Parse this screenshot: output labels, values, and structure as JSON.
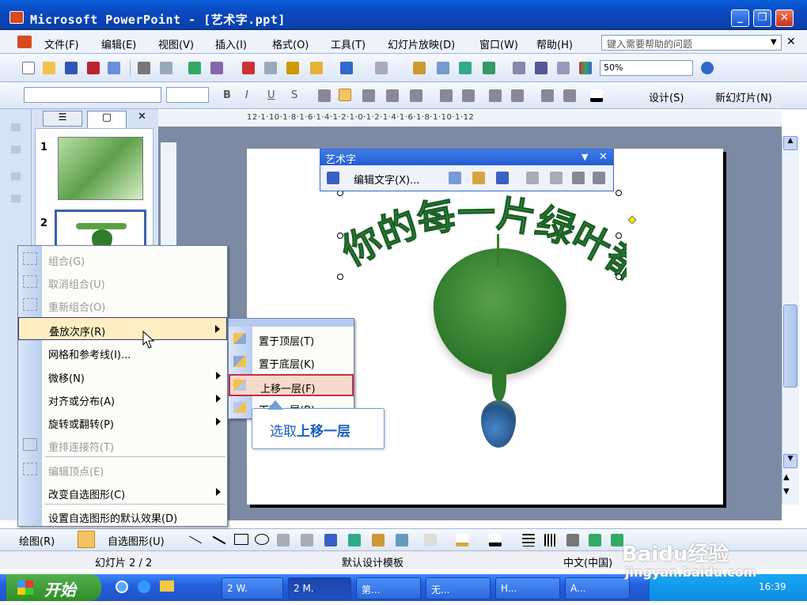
{
  "window": {
    "title": "Microsoft PowerPoint - [艺术字.ppt]",
    "min": "_",
    "restore": "❐",
    "close": "✕"
  },
  "menu": {
    "items": [
      "文件(F)",
      "编辑(E)",
      "视图(V)",
      "插入(I)",
      "格式(O)",
      "工具(T)",
      "幻灯片放映(D)",
      "窗口(W)",
      "帮助(H)"
    ],
    "help_placeholder": "键入需要帮助的问题"
  },
  "toolbar": {
    "zoom": "50%"
  },
  "format_bar": {
    "bold": "B",
    "italic": "I",
    "underline": "U",
    "shadow": "S",
    "design_label": "设计(S)",
    "new_slide_label": "新幻灯片(N)"
  },
  "ruler": {
    "text": "12·1·10·1·8·1·6·1·4·1·2·1·0·1·2·1·4·1·6·1·8·1·10·1·12"
  },
  "thumbs": {
    "tab_outline": "☰",
    "tab_slides": "▢",
    "close": "✕",
    "slide1": "1",
    "slide2": "2"
  },
  "wordart_toolbar": {
    "title": "艺术字",
    "edit_text": "编辑文字(X)..."
  },
  "slide": {
    "wordart": "你的每一片绿叶都是"
  },
  "context_menu": {
    "items": [
      {
        "label": "组合(G)",
        "disabled": true
      },
      {
        "label": "取消组合(U)",
        "disabled": true
      },
      {
        "label": "重新组合(O)",
        "disabled": true
      },
      {
        "label": "叠放次序(R)",
        "disabled": false
      },
      {
        "label": "网格和参考线(I)...",
        "disabled": false
      },
      {
        "label": "微移(N)",
        "disabled": false
      },
      {
        "label": "对齐或分布(A)",
        "disabled": false
      },
      {
        "label": "旋转或翻转(P)",
        "disabled": false
      },
      {
        "label": "重排连接符(T)",
        "disabled": true
      },
      {
        "label": "编辑顶点(E)",
        "disabled": true
      },
      {
        "label": "改变自选图形(C)",
        "disabled": false
      },
      {
        "label": "设置自选图形的默认效果(D)",
        "disabled": false
      }
    ]
  },
  "submenu": {
    "items": [
      "置于顶层(T)",
      "置于底层(K)",
      "上移一层(F)",
      "下移一层(B)"
    ]
  },
  "callout": {
    "text_prefix": "选取",
    "text_bold": "上移一层"
  },
  "drawbar": {
    "draw_label": "绘图(R)",
    "autoshape_label": "自选图形(U)"
  },
  "status": {
    "slide": "幻灯片 2 / 2",
    "template": "默认设计模板",
    "lang": "中文(中国)"
  },
  "taskbar": {
    "start": "开始",
    "tasks": [
      "2 W.",
      "2 M.",
      "第...",
      "无...",
      "H...",
      "A..."
    ],
    "clock": "16:39"
  },
  "watermark": {
    "brand": "Baidu经验",
    "url": "jingyan.baidu.com"
  },
  "colors": {
    "xp_blue": "#245bd3",
    "leaf_green": "#2f7a2c",
    "wordart_green": "#2e8b3a",
    "highlight": "#ffeec2",
    "callout_blue": "#1b5fc4"
  }
}
